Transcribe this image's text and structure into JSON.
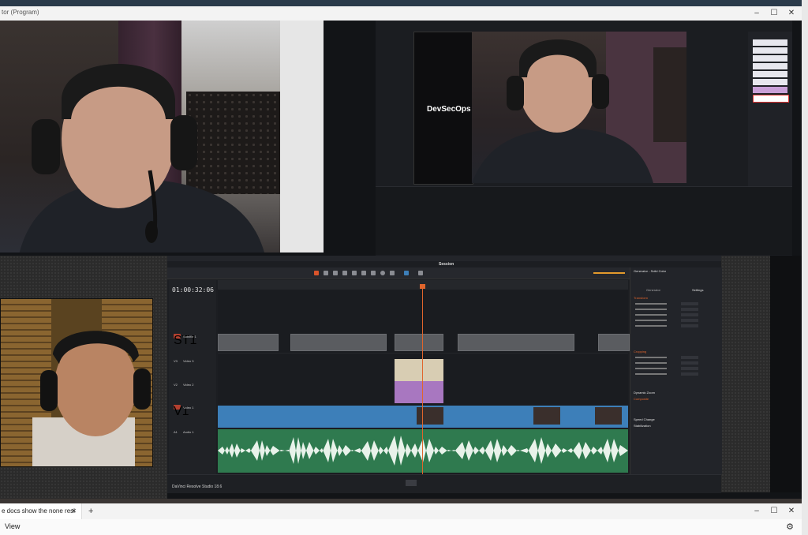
{
  "window": {
    "title": "tor (Program)",
    "minimize": "–",
    "maximize": "☐",
    "close": "✕"
  },
  "preview": {
    "caption": "DevSecOps"
  },
  "resolve": {
    "menu": [
      "DaVinci Resolve",
      "File",
      "Edit",
      "Trim",
      "Timeline",
      "Clip",
      "Mark",
      "View",
      "Playback",
      "Fusion",
      "Color",
      "Fairlight",
      "Workspace",
      "Help"
    ],
    "project_title": "Session",
    "timecode": "01:00:32:06",
    "tracks": [
      {
        "badge": "ST1",
        "name": "Subtitle 1"
      },
      {
        "badge": "V3",
        "name": "Video 3"
      },
      {
        "badge": "V2",
        "name": "Video 2"
      },
      {
        "badge": "V1",
        "name": "Video 1"
      },
      {
        "badge": "A1",
        "name": "Audio 1"
      }
    ],
    "inspector": {
      "title": "Generator - Solid Color",
      "tabs": [
        "Generator",
        "Settings"
      ],
      "sections": [
        "Transform",
        "Cropping",
        "Dynamic Zoom",
        "Composite",
        "Speed Change",
        "Stabilization"
      ]
    },
    "brand": "DaVinci Resolve Studio 18.6"
  },
  "browser": {
    "tab_title": "e docs  show the none resi",
    "tab_close": "✕",
    "new_tab": "+",
    "menu_view": "View",
    "settings_icon": "⚙"
  },
  "colors": {
    "playhead": "#e0652c",
    "clip_video": "#3d7fb9",
    "clip_audio": "#2f7a4f",
    "clip_purple": "#a877c0",
    "clip_beige": "#d8cdb3"
  }
}
